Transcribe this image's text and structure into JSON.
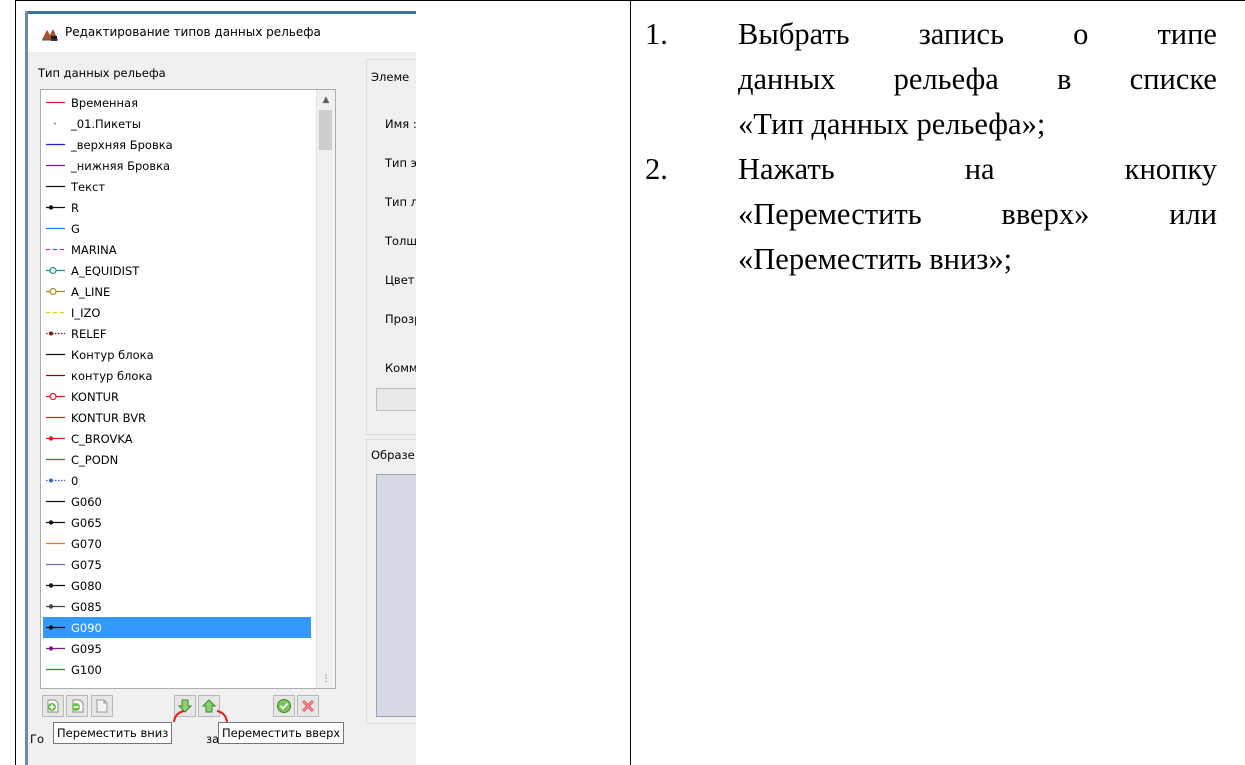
{
  "window": {
    "title": "Редактирование типов данных рельефа"
  },
  "list_group": {
    "label": "Тип данных рельефа"
  },
  "terrain_types": [
    {
      "label": "Временная",
      "color": "#d42020",
      "style": "solid"
    },
    {
      "label": "_01.Пикеты",
      "color": "#666666",
      "style": "dot"
    },
    {
      "label": "_верхняя Бровка",
      "color": "#2222cc",
      "style": "solid"
    },
    {
      "label": "_нижняя Бровка",
      "color": "#8a1a8a",
      "style": "solid"
    },
    {
      "label": "Текст",
      "color": "#111111",
      "style": "solid"
    },
    {
      "label": "R",
      "color": "#111111",
      "style": "marker"
    },
    {
      "label": "G",
      "color": "#2a7fd6",
      "style": "solid"
    },
    {
      "label": "MARINA",
      "color": "#e020c0",
      "style": "dash"
    },
    {
      "label": "A_EQUIDIST",
      "color": "#1e8a8a",
      "style": "circle"
    },
    {
      "label": "A_LINE",
      "color": "#a09020",
      "style": "circle"
    },
    {
      "label": "I_IZO",
      "color": "#e8d000",
      "style": "dash"
    },
    {
      "label": "RELEF",
      "color": "#8a1010",
      "style": "dotmarker"
    },
    {
      "label": "Контур блока",
      "color": "#111111",
      "style": "solid"
    },
    {
      "label": "контур блока",
      "color": "#7a1010",
      "style": "solid"
    },
    {
      "label": "KONTUR",
      "color": "#d42020",
      "style": "circle"
    },
    {
      "label": "KONTUR BVR",
      "color": "#d42020",
      "style": "solid"
    },
    {
      "label": "C_BROVKA",
      "color": "#d42020",
      "style": "marker"
    },
    {
      "label": "C_PODN",
      "color": "#1a8a3a",
      "style": "solid"
    },
    {
      "label": "0",
      "color": "#2a6ad6",
      "style": "dotmarker"
    },
    {
      "label": "G060",
      "color": "#111111",
      "style": "solid"
    },
    {
      "label": "G065",
      "color": "#111111",
      "style": "marker"
    },
    {
      "label": "G070",
      "color": "#e0801a",
      "style": "solid"
    },
    {
      "label": "G075",
      "color": "#7a6aaa",
      "style": "solid"
    },
    {
      "label": "G080",
      "color": "#111111",
      "style": "marker"
    },
    {
      "label": "G085",
      "color": "#444444",
      "style": "marker"
    },
    {
      "label": "G090",
      "color": "#111111",
      "style": "marker",
      "selected": true
    },
    {
      "label": "G095",
      "color": "#7a1a7a",
      "style": "marker"
    },
    {
      "label": "G100",
      "color": "#1a8a3a",
      "style": "solid"
    }
  ],
  "elements_panel": {
    "title": "Элеме",
    "fields": [
      "Имя :",
      "Тип э",
      "Тип ли",
      "Толщ",
      "Цвет :",
      "Прозр",
      "Комм"
    ]
  },
  "preview_panel": {
    "title": "Образе"
  },
  "toolbar": {
    "move_down_tooltip": "Переместить вниз",
    "move_up_tooltip": "Переместить вверх"
  },
  "bottom_fragments": {
    "left": "Го",
    "middle": "за"
  },
  "instructions": [
    {
      "number": "1.",
      "text": "Выбрать запись о типе данных рельефа в списке «Тип данных рельефа»;"
    },
    {
      "number": "2.",
      "text": "Нажать на кнопку «Переместить вверх» или «Переместить вниз»;"
    }
  ]
}
